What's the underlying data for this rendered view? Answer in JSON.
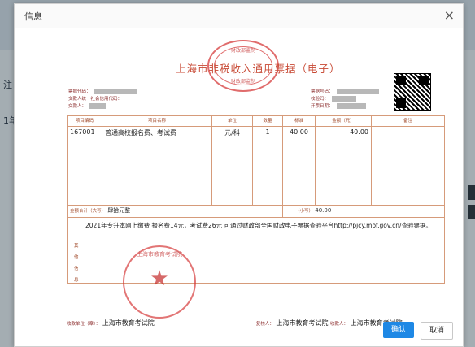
{
  "dialog": {
    "title": "信息",
    "close_glyph": "×",
    "confirm_label": "确认",
    "cancel_label": "取消"
  },
  "background": {
    "left_label_1": "注",
    "left_label_2": "1年"
  },
  "invoice": {
    "title": "上海市非税收入通用票据（电子）",
    "seal_top_line1": "财政部监制",
    "seal_top_line2": "财政部监制",
    "meta_left_1": "票据代码：",
    "meta_left_2": "交款人统一社会信用代码：",
    "meta_left_3": "交款人：",
    "meta_right_1": "票据号码：",
    "meta_right_2": "校验码：",
    "meta_right_3": "开票日期：",
    "headers": [
      "项目编码",
      "项目名称",
      "单位",
      "数量",
      "标准",
      "金额（元）",
      "备注"
    ],
    "item": {
      "code": "167001",
      "name": "普通高校报名费、考试费",
      "unit": "元/科",
      "qty": "1",
      "std": "40.00",
      "amount": "40.00",
      "remark": ""
    },
    "total_upper_label": "金额合计（大写）",
    "total_upper_value": "肆拾元整",
    "total_lower_label": "（小写）",
    "total_lower_value": "40.00",
    "note_text": "2021年专升本网上缴费  报名费14元，考试费26元  可通过财政部全国财政电子票据查验平台http://pjcy.mof.gov.cn/查验票据。",
    "note_side": [
      "其",
      "他",
      "信",
      "息"
    ],
    "seal_bottom_text": "上海市教育考试院",
    "seal_bottom_star": "★",
    "payee_unit_label": "收款单位（章）：",
    "payee_unit_value": "上海市教育考试院",
    "reviewer_label": "复核人：",
    "reviewer_value": "上海市教育考试院",
    "collector_label": "收款人：",
    "collector_value": "上海市教育考试院"
  }
}
